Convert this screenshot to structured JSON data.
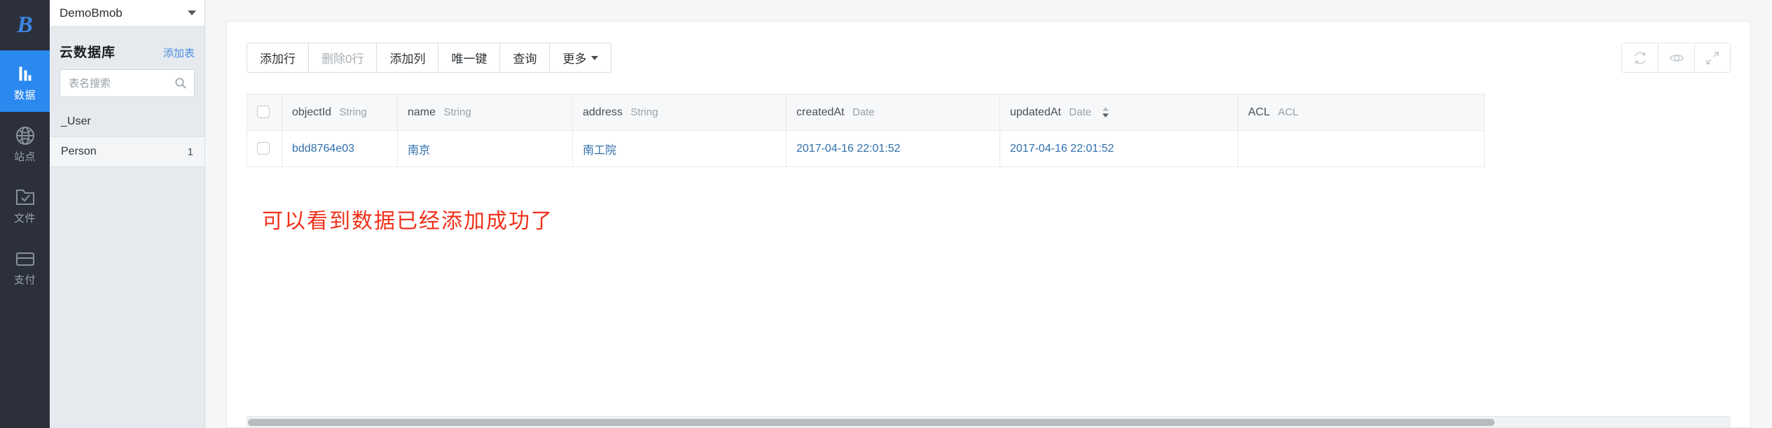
{
  "rail": {
    "logo": "B",
    "items": [
      {
        "label": "数据",
        "icon": "bar-chart-icon",
        "active": true
      },
      {
        "label": "站点",
        "icon": "globe-icon",
        "active": false
      },
      {
        "label": "文件",
        "icon": "folder-check-icon",
        "active": false
      },
      {
        "label": "支付",
        "icon": "credit-card-icon",
        "active": false
      }
    ]
  },
  "panel": {
    "project": "DemoBmob",
    "title": "云数据库",
    "add_table_label": "添加表",
    "search_placeholder": "表名搜索",
    "search_value": "",
    "tables": [
      {
        "name": "_User",
        "count": "",
        "selected": false
      },
      {
        "name": "Person",
        "count": "1",
        "selected": true
      }
    ]
  },
  "toolbar": {
    "buttons": [
      {
        "label": "添加行",
        "disabled": false,
        "caret": false
      },
      {
        "label": "删除0行",
        "disabled": true,
        "caret": false
      },
      {
        "label": "添加列",
        "disabled": false,
        "caret": false
      },
      {
        "label": "唯一键",
        "disabled": false,
        "caret": false
      },
      {
        "label": "查询",
        "disabled": false,
        "caret": false
      },
      {
        "label": "更多",
        "disabled": false,
        "caret": true
      }
    ],
    "icon_buttons": [
      {
        "name": "refresh-icon"
      },
      {
        "name": "eye-icon"
      },
      {
        "name": "expand-icon"
      }
    ]
  },
  "grid": {
    "columns": [
      {
        "name": "objectId",
        "type": "String",
        "sortable": false
      },
      {
        "name": "name",
        "type": "String",
        "sortable": false
      },
      {
        "name": "address",
        "type": "String",
        "sortable": false
      },
      {
        "name": "createdAt",
        "type": "Date",
        "sortable": false
      },
      {
        "name": "updatedAt",
        "type": "Date",
        "sortable": true
      },
      {
        "name": "ACL",
        "type": "ACL",
        "sortable": false
      }
    ],
    "rows": [
      {
        "objectId": "bdd8764e03",
        "name": "南京",
        "address": "南工院",
        "createdAt": "2017-04-16 22:01:52",
        "updatedAt": "2017-04-16 22:01:52",
        "ACL": ""
      }
    ]
  },
  "annotation": {
    "text": "可以看到数据已经添加成功了",
    "color": "#f0311b"
  },
  "colors": {
    "accent": "#2a89ef",
    "rail_bg": "#2b303b",
    "panel_bg": "#e6eaee",
    "link": "#2f6fad",
    "add_table_link": "#4a90e2"
  }
}
